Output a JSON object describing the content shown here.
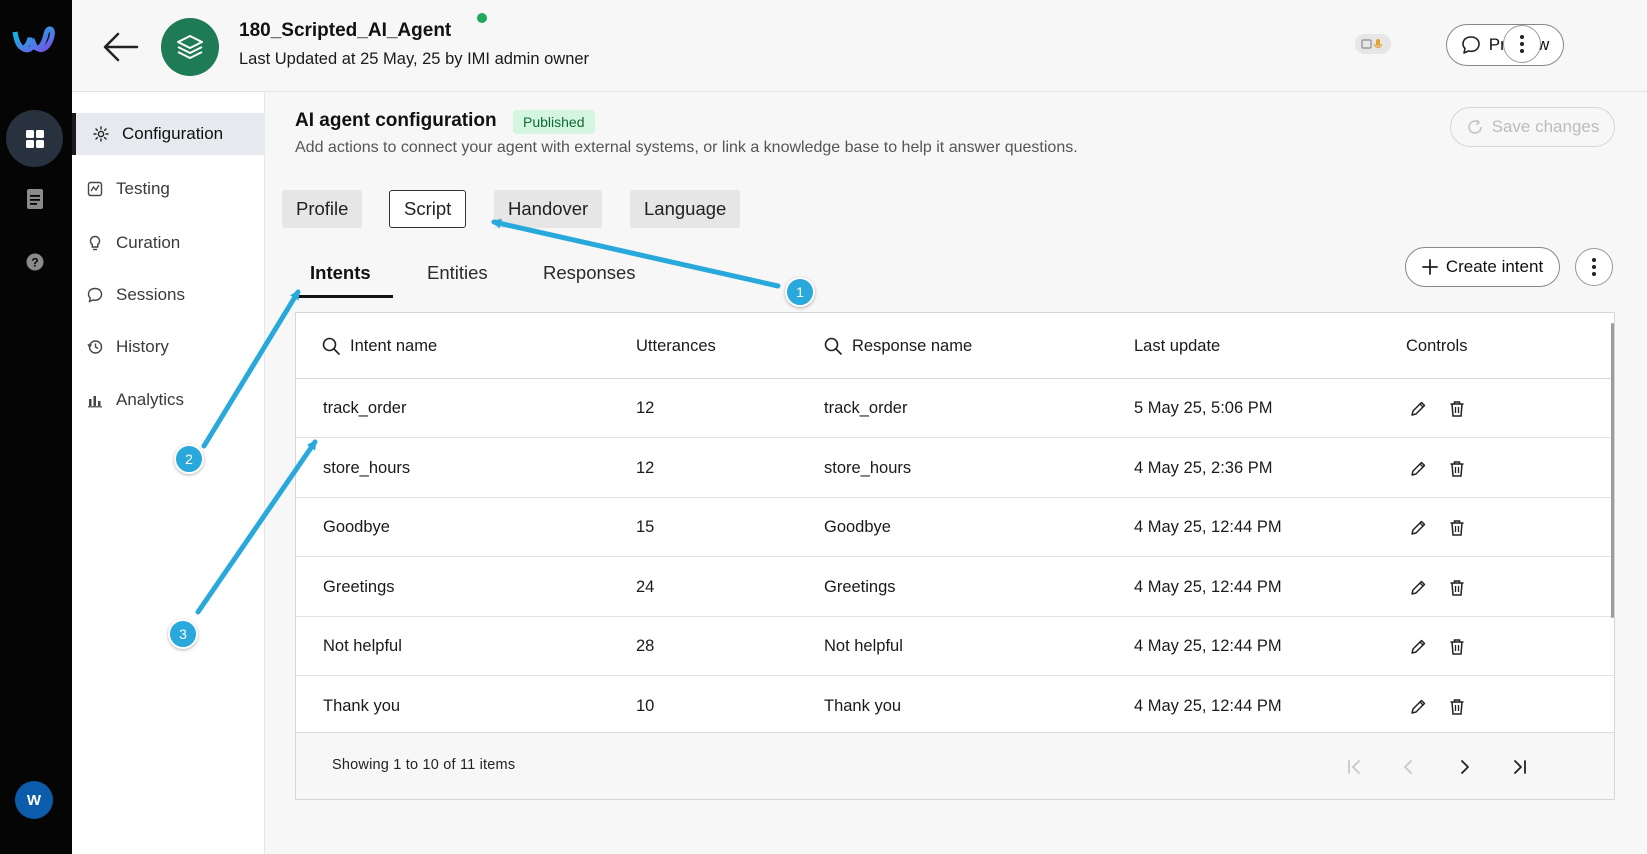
{
  "header": {
    "agent_title": "180_Scripted_AI_Agent",
    "agent_subtitle": "Last Updated at 25 May, 25 by IMI admin owner",
    "preview_label": "Preview"
  },
  "rail": {
    "avatar_initial": "W"
  },
  "sidebar": {
    "items": [
      {
        "label": "Configuration",
        "icon": "gear-icon",
        "active": true
      },
      {
        "label": "Testing",
        "icon": "testing-icon"
      },
      {
        "label": "Curation",
        "icon": "lightbulb-icon"
      },
      {
        "label": "Sessions",
        "icon": "chat-icon"
      },
      {
        "label": "History",
        "icon": "history-icon"
      },
      {
        "label": "Analytics",
        "icon": "analytics-icon"
      }
    ]
  },
  "main": {
    "title": "AI agent configuration",
    "status_badge": "Published",
    "description": "Add actions to connect your agent with external systems, or link a knowledge base to help it answer questions.",
    "save_label": "Save changes",
    "tabs": [
      {
        "label": "Profile"
      },
      {
        "label": "Script",
        "active": true
      },
      {
        "label": "Handover"
      },
      {
        "label": "Language"
      }
    ],
    "subtabs": [
      {
        "label": "Intents",
        "active": true
      },
      {
        "label": "Entities"
      },
      {
        "label": "Responses"
      }
    ],
    "create_label": "Create intent"
  },
  "table": {
    "columns": [
      "Intent name",
      "Utterances",
      "Response name",
      "Last update",
      "Controls"
    ],
    "rows": [
      {
        "intent": "track_order",
        "utterances": "12",
        "response": "track_order",
        "updated": "5 May 25, 5:06 PM"
      },
      {
        "intent": "store_hours",
        "utterances": "12",
        "response": "store_hours",
        "updated": "4 May 25, 2:36 PM"
      },
      {
        "intent": "Goodbye",
        "utterances": "15",
        "response": "Goodbye",
        "updated": "4 May 25, 12:44 PM"
      },
      {
        "intent": "Greetings",
        "utterances": "24",
        "response": "Greetings",
        "updated": "4 May 25, 12:44 PM"
      },
      {
        "intent": "Not helpful",
        "utterances": "28",
        "response": "Not helpful",
        "updated": "4 May 25, 12:44 PM"
      },
      {
        "intent": "Thank you",
        "utterances": "10",
        "response": "Thank you",
        "updated": "4 May 25, 12:44 PM"
      }
    ],
    "footer": "Showing 1 to 10 of 11 items"
  },
  "annotations": [
    {
      "label": "1"
    },
    {
      "label": "2"
    },
    {
      "label": "3"
    }
  ],
  "colors": {
    "accent_callout": "#29a8dc",
    "status_published_bg": "#d4f5df",
    "agent_avatar": "#1f7a56",
    "online_dot": "#1eaa5a"
  }
}
